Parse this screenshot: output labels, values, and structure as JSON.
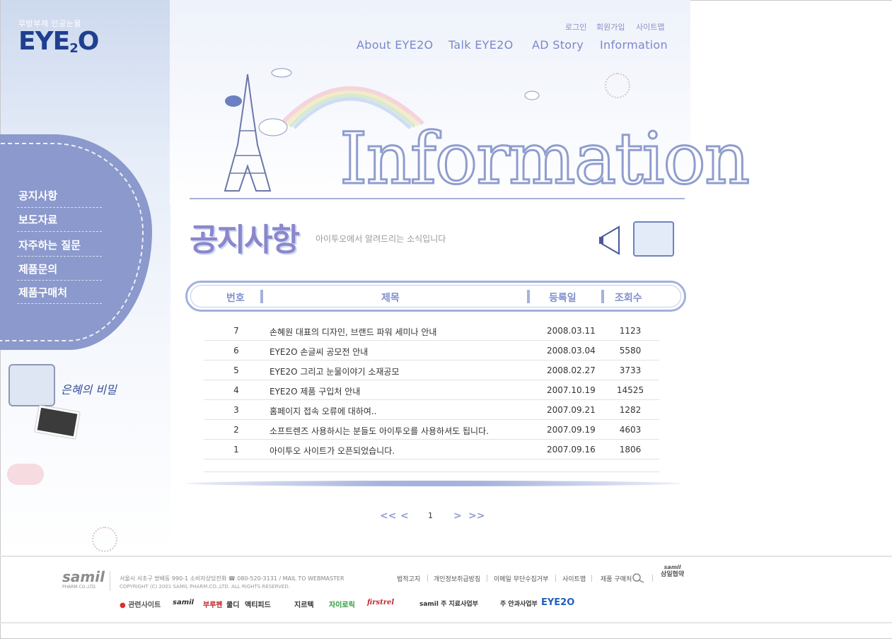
{
  "brand": {
    "tagline": "무방부제 인공눈물",
    "logo_main": "EYE",
    "logo_sub": "2",
    "logo_end": "O"
  },
  "util_nav": [
    "로그인",
    "회원가입",
    "사이트맵"
  ],
  "gnb": [
    "About EYE2O",
    "Talk EYE2O",
    "AD Story",
    "Information"
  ],
  "hero": {
    "title": "Information"
  },
  "lnb": {
    "items": [
      "공지사항",
      "보도자료",
      "자주하는 질문",
      "제품문의",
      "제품구매처"
    ],
    "promo": "은혜의 비밀"
  },
  "page": {
    "heading": "공지사항",
    "description": "아이투오에서 알려드리는 소식입니다"
  },
  "table": {
    "headers": [
      "번호",
      "제목",
      "등록일",
      "조회수"
    ],
    "rows": [
      {
        "num": "7",
        "title": "손혜원 대표의 디자인, 브랜드 파워 세미나 안내",
        "date": "2008.03.11",
        "hits": "1123"
      },
      {
        "num": "6",
        "title": "EYE2O 손글씨 공모전 안내",
        "date": "2008.03.04",
        "hits": "5580"
      },
      {
        "num": "5",
        "title": "EYE2O 그리고 눈물이야기 소재공모",
        "date": "2008.02.27",
        "hits": "3733"
      },
      {
        "num": "4",
        "title": "EYE2O 제품 구입처 안내",
        "date": "2007.10.19",
        "hits": "14525"
      },
      {
        "num": "3",
        "title": "홈페이지 접속 오류에 대하여..",
        "date": "2007.09.21",
        "hits": "1282"
      },
      {
        "num": "2",
        "title": "소프트렌즈 사용하시는 분들도 아이투오를 사용하셔도 됩니다.",
        "date": "2007.09.19",
        "hits": "4603"
      },
      {
        "num": "1",
        "title": "아이투오 사이트가 오픈되었습니다.",
        "date": "2007.09.16",
        "hits": "1806"
      }
    ]
  },
  "pagination": {
    "first": "<<",
    "prev": "<",
    "current": "1",
    "next": ">",
    "last": ">>"
  },
  "footer": {
    "logo": "samil",
    "logo_sub": "PHARM.CO.,LTD.",
    "address": "서울시 서초구 방배동 990-1 소비자상담전화 ☎ 080-520-3131  /  MAIL TO WEBMASTER",
    "copyright": "COPYRIGHT (C) 2001 SAMIL PHARM.CO.,LTD. ALL RIGHTS RESERVED.",
    "links": [
      "법적고지",
      "개인정보취급방침",
      "이메일 무단수집거부",
      "사이트맵",
      "제품 구매처"
    ],
    "corp_small": "samil",
    "corp": "삼일협약",
    "family_label": "관련사이트",
    "family": [
      "samil",
      "부루펜",
      "쿨디",
      "액티피드",
      "지르텍",
      "자이로릭",
      "firstrel",
      "samil 주 지료사업부",
      "주 안과사업부",
      "EYE2O"
    ]
  },
  "colors": {
    "accent": "#8b99cc",
    "header_text": "#7a88cc",
    "logo": "#1f3f8f"
  }
}
